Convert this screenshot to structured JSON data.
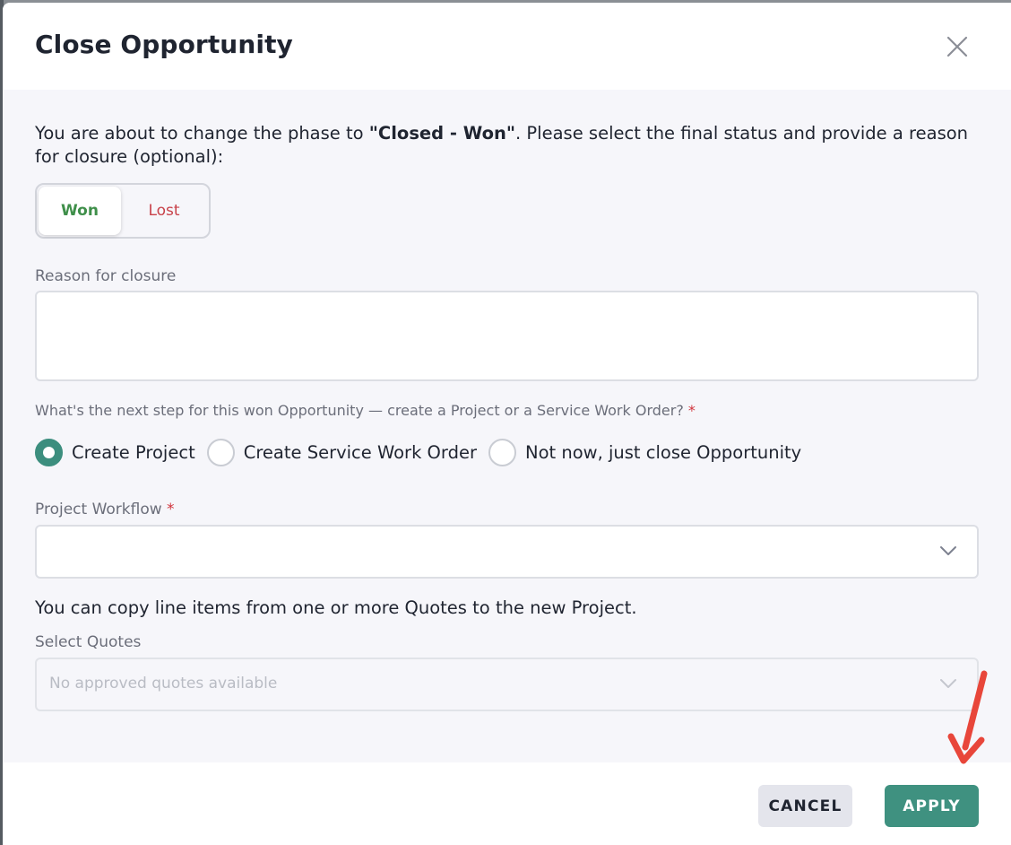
{
  "dialog": {
    "title": "Close Opportunity",
    "close_icon": "close-icon"
  },
  "intro": {
    "before": "You are about to change the phase to ",
    "phase": "\"Closed - Won\"",
    "after": ". Please select the final status and provide a reason for closure (optional):"
  },
  "status_toggle": {
    "options": [
      "Won",
      "Lost"
    ],
    "selected": "Won",
    "colors": {
      "won": "#3f8f4a",
      "lost": "#c8424a"
    }
  },
  "reason": {
    "label": "Reason for closure",
    "value": ""
  },
  "next_step": {
    "question": "What's the next step for this won Opportunity — create a Project or a Service Work Order?",
    "required_mark": "*",
    "options": [
      "Create Project",
      "Create Service Work Order",
      "Not now, just close Opportunity"
    ],
    "selected": "Create Project"
  },
  "project_workflow": {
    "label": "Project Workflow",
    "required_mark": "*",
    "value": "",
    "icon": "chevron-down-icon"
  },
  "quotes": {
    "note": "You can copy line items from one or more Quotes to the new Project.",
    "label": "Select Quotes",
    "placeholder": "No approved quotes available",
    "disabled": true,
    "icon": "chevron-down-icon"
  },
  "footer": {
    "cancel_label": "CANCEL",
    "apply_label": "APPLY"
  },
  "colors": {
    "accent": "#3f9180",
    "required": "#d0333b",
    "annotation_arrow": "#e8463a"
  }
}
